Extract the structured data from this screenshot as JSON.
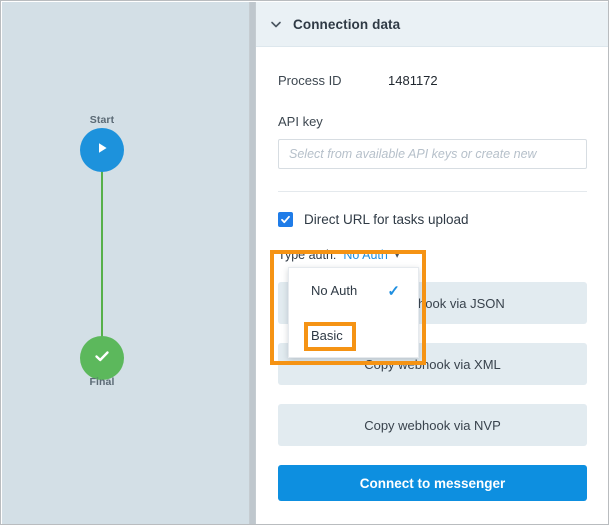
{
  "flow": {
    "nodes": [
      {
        "id": "start",
        "label": "Start",
        "icon": "play-icon",
        "color": "#1d92dc"
      },
      {
        "id": "final",
        "label": "Final",
        "icon": "check-icon",
        "color": "#5cb85c"
      }
    ],
    "edge_color": "#56b04a",
    "canvas_bg": "#d3dfe6"
  },
  "panel": {
    "header": {
      "title": "Connection data",
      "collapse_icon": "chevron-down-icon",
      "bg": "#eaf1f5"
    },
    "process": {
      "label": "Process ID",
      "value": "1481172"
    },
    "api_key": {
      "label": "API key",
      "value": "",
      "placeholder": "Select from available API keys or create new"
    },
    "direct_url": {
      "label": "Direct URL for tasks upload",
      "checked": true,
      "checkbox_color": "#1f7ce8",
      "check_glyph": "✓"
    },
    "type_auth": {
      "label": "Type auth:",
      "selected": "No Auth",
      "caret_glyph": "▾",
      "accent": "#1f8fe0",
      "options": [
        {
          "label": "No Auth",
          "selected": true,
          "check_glyph": "✓"
        },
        {
          "label": "Basic",
          "selected": false,
          "check_glyph": ""
        }
      ]
    },
    "buttons": [
      {
        "name": "copy-webhook-json",
        "label": "Copy webhook via JSON",
        "style": "secondary"
      },
      {
        "name": "copy-webhook-xml",
        "label": "Copy webhook via XML",
        "style": "secondary"
      },
      {
        "name": "copy-webhook-nvp",
        "label": "Copy webhook via NVP",
        "style": "secondary"
      }
    ],
    "primary_button": {
      "label": "Connect to messenger",
      "color": "#0d8fe0"
    }
  },
  "annotations": {
    "color": "#f59314",
    "boxes": [
      {
        "name": "type-auth-dropdown-highlight"
      },
      {
        "name": "basic-option-highlight"
      }
    ]
  }
}
